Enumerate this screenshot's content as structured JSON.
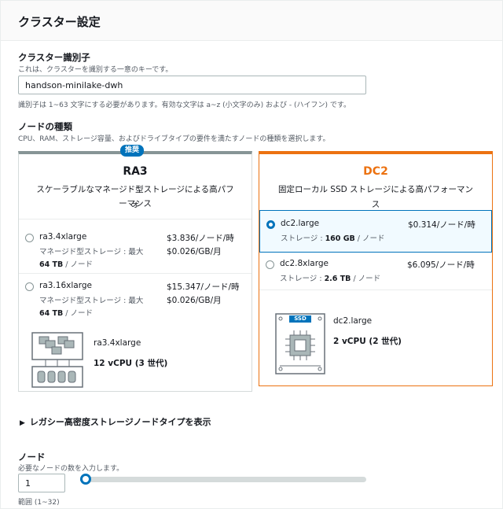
{
  "header": {
    "title": "クラスター設定"
  },
  "identifier": {
    "label": "クラスター識別子",
    "description": "これは、クラスターを識別する一意のキーです。",
    "value": "handson-minilake-dwh",
    "constraint": "識別子は 1~63 文字にする必要があります。有効な文字は a~z (小文字のみ) および - (ハイフン) です。"
  },
  "node_type": {
    "label": "ノードの種類",
    "description": "CPU、RAM、ストレージ容量、およびドライブタイプの要件を満たすノードの種類を選択します。"
  },
  "ra3": {
    "badge": "推奨",
    "title": "RA3",
    "subtitle_line1": "スケーラブルなマネージド型ストレージによる高パフォ",
    "subtitle_line2": "ーマンス",
    "options": [
      {
        "name": "ra3.4xlarge",
        "storage_prefix": "マネージド型ストレージ : 最大",
        "storage_value": "64 TB",
        "storage_suffix": "/ ノード",
        "price_node": "$3.836/ノード/時",
        "price_storage": "$0.026/GB/月"
      },
      {
        "name": "ra3.16xlarge",
        "storage_prefix": "マネージド型ストレージ : 最大",
        "storage_value": "64 TB",
        "storage_suffix": "/ ノード",
        "price_node": "$15.347/ノード/時",
        "price_storage": "$0.026/GB/月"
      }
    ],
    "spec_name": "ra3.4xlarge",
    "spec_cpu": "12 vCPU (3 世代)"
  },
  "dc2": {
    "title": "DC2",
    "subtitle": "固定ローカル SSD ストレージによる高パフォーマンス",
    "options": [
      {
        "name": "dc2.large",
        "storage_prefix": "ストレージ : ",
        "storage_value": "160 GB",
        "storage_suffix": "/ ノード",
        "price_node": "$0.314/ノード/時",
        "selected": true
      },
      {
        "name": "dc2.8xlarge",
        "storage_prefix": "ストレージ : ",
        "storage_value": "2.6 TB",
        "storage_suffix": "/ ノード",
        "price_node": "$6.095/ノード/時",
        "selected": false
      }
    ],
    "ssd_label": "SSD",
    "spec_name": "dc2.large",
    "spec_cpu": "2 vCPU (2 世代)"
  },
  "legacy_toggle": "レガシー高密度ストレージノードタイプを表示",
  "nodes": {
    "label": "ノード",
    "description": "必要なノードの数を入力します。",
    "value": "1",
    "range": "範囲 (1~32)",
    "slider_fraction": 0.0
  },
  "colors": {
    "accent": "#0073bb",
    "dc2_orange": "#ec7211",
    "ra3_gray": "#879596"
  }
}
